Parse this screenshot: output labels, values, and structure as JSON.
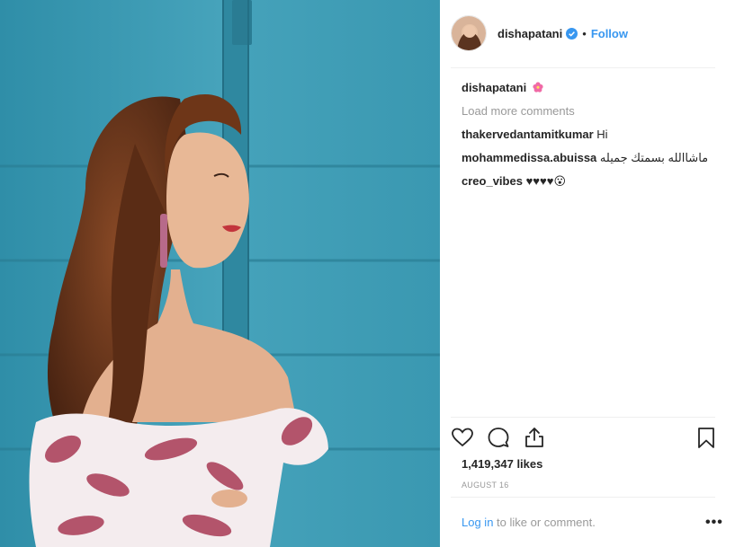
{
  "header": {
    "username": "dishapatani",
    "separator": "•",
    "follow_label": "Follow",
    "verified_icon": "verified-badge-icon"
  },
  "comments": [
    {
      "user": "dishapatani",
      "text": "",
      "emoji": "hibiscus"
    },
    {
      "user": "thakervedantamitkumar",
      "text": "Hi"
    },
    {
      "user": "mohammedissa.abuissa",
      "text": "ماشاالله بسمتك جميله"
    },
    {
      "user": "creo_vibes",
      "text": "♥♥♥♥😮"
    }
  ],
  "load_more_label": "Load more comments",
  "actions": {
    "like_icon": "heart-outline-icon",
    "comment_icon": "comment-bubble-icon",
    "share_icon": "share-upload-icon",
    "save_icon": "bookmark-icon"
  },
  "likes_label": "1,419,347 likes",
  "date_label": "AUGUST 16",
  "footer": {
    "login_label": "Log in",
    "suffix": " to like or comment.",
    "more_label": "•••"
  },
  "colors": {
    "link_blue": "#3897f0",
    "muted_gray": "#999999",
    "wall_teal": "#3f9bb3",
    "heart_red": "#c8102e"
  }
}
